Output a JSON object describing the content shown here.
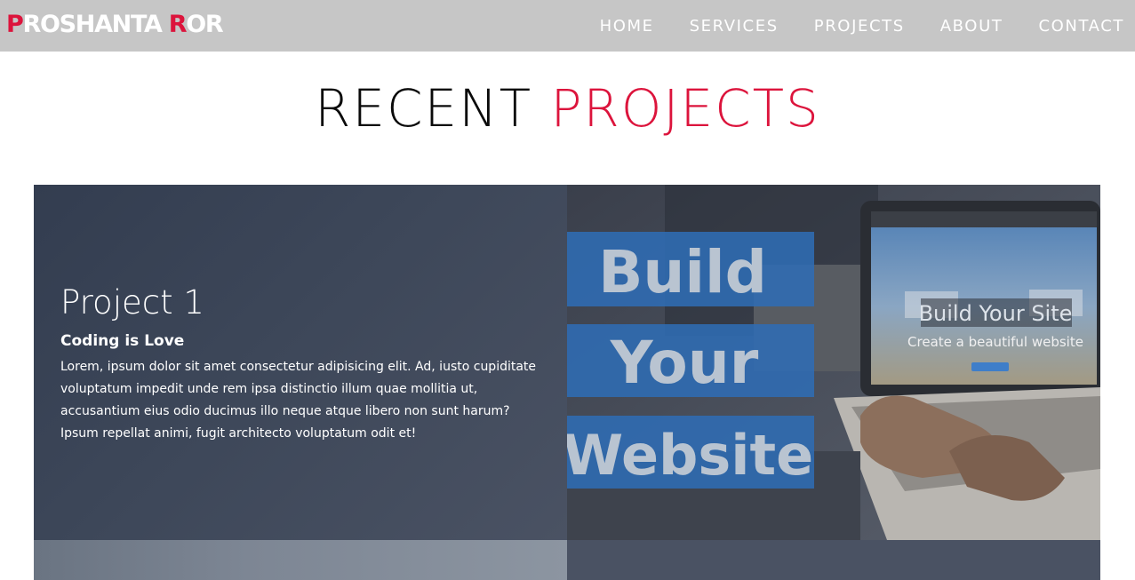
{
  "brand": {
    "first_initial": "P",
    "first_rest": "ROSHANTA ",
    "last_initial": "R",
    "last_rest": "OR"
  },
  "nav": {
    "items": [
      "HOME",
      "SERVICES",
      "PROJECTS",
      "ABOUT",
      "CONTACT"
    ]
  },
  "section": {
    "title_part1": "RECENT ",
    "title_part2": "PROJECTS"
  },
  "project1": {
    "title": "Project 1",
    "subtitle": "Coding is Love",
    "description": "Lorem, ipsum dolor sit amet consectetur adipisicing elit. Ad, iusto cupiditate voluptatum impedit unde rem ipsa distinctio illum quae mollitia ut, accusantium eius odio ducimus illo neque atque libero non sunt harum? Ipsum repellat animi, fugit architecto voluptatum odit et!",
    "image": {
      "line1": "Build",
      "line2": "Your",
      "line3": "Website",
      "screen_headline": "Build Your Site",
      "screen_subline": "Create a beautiful website"
    }
  },
  "colors": {
    "accent": "#dc143c",
    "navbar": "#c6c6c6",
    "card": "#3a4456",
    "banner": "#2f6cb4"
  }
}
